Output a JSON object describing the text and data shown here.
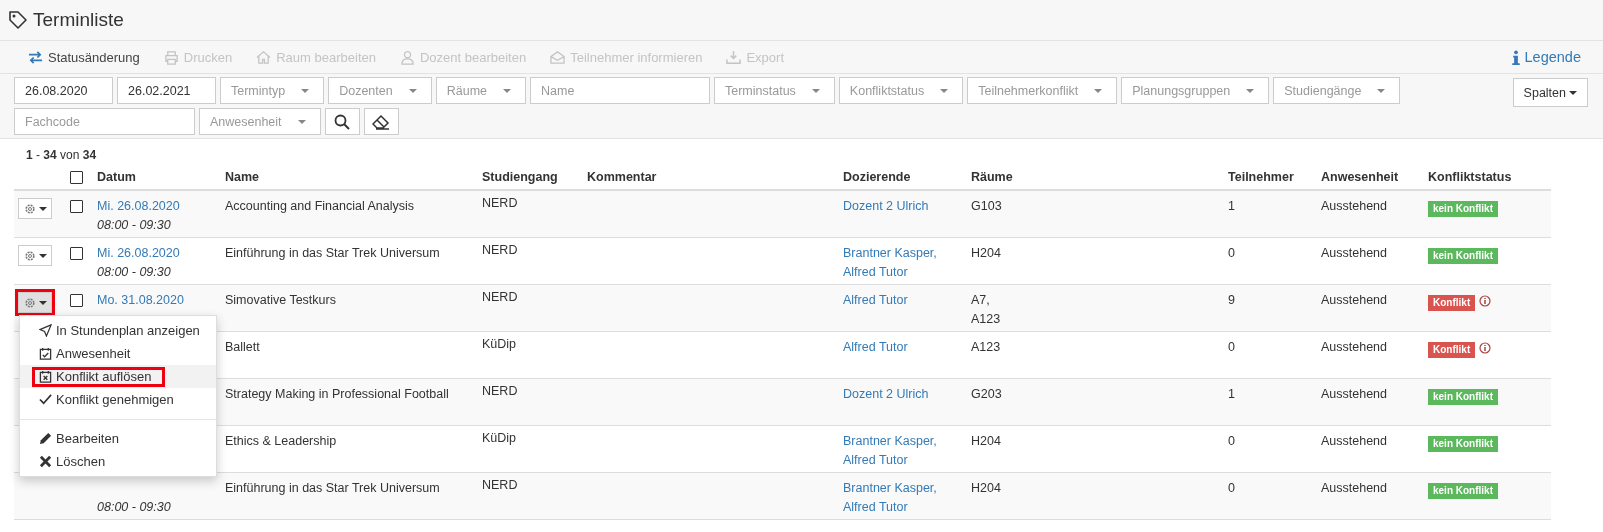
{
  "title": "Terminliste",
  "toolbar": [
    {
      "label": "Statusänderung",
      "disabled": false
    },
    {
      "label": "Drucken",
      "disabled": true
    },
    {
      "label": "Raum bearbeiten",
      "disabled": true
    },
    {
      "label": "Dozent bearbeiten",
      "disabled": true
    },
    {
      "label": "Teilnehmer informieren",
      "disabled": true
    },
    {
      "label": "Export",
      "disabled": true
    }
  ],
  "legend": {
    "label": "Legende"
  },
  "filters": [
    {
      "kind": "date",
      "value": "26.08.2020"
    },
    {
      "kind": "date",
      "value": "26.02.2021"
    },
    {
      "kind": "select",
      "placeholder": "Termintyp"
    },
    {
      "kind": "select",
      "placeholder": "Dozenten"
    },
    {
      "kind": "select",
      "placeholder": "Räume"
    },
    {
      "kind": "text",
      "placeholder": "Name"
    },
    {
      "kind": "select",
      "placeholder": "Terminstatus"
    },
    {
      "kind": "select",
      "placeholder": "Konfliktstatus"
    },
    {
      "kind": "select",
      "placeholder": "Teilnehmerkonflikt"
    },
    {
      "kind": "select",
      "placeholder": "Planungsgruppen"
    },
    {
      "kind": "select",
      "placeholder": "Studiengänge"
    },
    {
      "kind": "text",
      "placeholder": "Fachcode"
    },
    {
      "kind": "select",
      "placeholder": "Anwesenheit"
    },
    {
      "kind": "search"
    },
    {
      "kind": "clear"
    }
  ],
  "columns_button": {
    "label": "Spalten"
  },
  "count": "**1** - **34** von **34**",
  "table": {
    "select_all_checked": false,
    "columns": [
      "Datum",
      "Name",
      "Studiengang",
      "Kommentar",
      "Dozierende",
      "Räume",
      "Teilnehmer",
      "Anwesenheit",
      "Konfliktstatus"
    ],
    "rows": [
      {
        "covered": false,
        "menu_open": false,
        "checked": false,
        "date": "Mi. 26.08.2020",
        "time": "08:00 - 09:30",
        "name": "Accounting and Financial Analysis",
        "study": "NERD",
        "lecturers": [
          "Dozent 2 Ulrich"
        ],
        "rooms": [
          "G103"
        ],
        "participants": "1",
        "attendance": "Ausstehend",
        "status": {
          "kind": "ok",
          "label": "kein Konflikt"
        }
      },
      {
        "covered": false,
        "menu_open": false,
        "checked": false,
        "date": "Mi. 26.08.2020",
        "time": "08:00 - 09:30",
        "name": "Einführung in das Star Trek Universum",
        "study": "NERD",
        "lecturers": [
          "Brantner Kasper,",
          "Alfred Tutor"
        ],
        "rooms": [
          "H204"
        ],
        "participants": "0",
        "attendance": "Ausstehend",
        "status": {
          "kind": "ok",
          "label": "kein Konflikt"
        }
      },
      {
        "covered": false,
        "menu_open": true,
        "checked": false,
        "date": "Mo. 31.08.2020",
        "name": "Simovative Testkurs",
        "study": "NERD",
        "lecturers": [
          "Alfred Tutor"
        ],
        "rooms": [
          "A7,",
          "A123"
        ],
        "participants": "9",
        "attendance": "Ausstehend",
        "status": {
          "kind": "conflict",
          "label": "Konflikt"
        }
      },
      {
        "covered": true,
        "name": "Ballett",
        "study": "KüDip",
        "lecturers": [
          "Alfred Tutor"
        ],
        "rooms": [
          "A123"
        ],
        "participants": "0",
        "attendance": "Ausstehend",
        "status": {
          "kind": "conflict",
          "label": "Konflikt"
        }
      },
      {
        "covered": true,
        "name": "Strategy Making in Professional Football",
        "study": "NERD",
        "lecturers": [
          "Dozent 2 Ulrich"
        ],
        "rooms": [
          "G203"
        ],
        "participants": "1",
        "attendance": "Ausstehend",
        "status": {
          "kind": "ok",
          "label": "kein Konflikt"
        }
      },
      {
        "covered": true,
        "name": "Ethics & Leadership",
        "study": "KüDip",
        "lecturers": [
          "Brantner Kasper,",
          "Alfred Tutor"
        ],
        "rooms": [
          "H204"
        ],
        "participants": "0",
        "attendance": "Ausstehend",
        "status": {
          "kind": "ok",
          "label": "kein Konflikt"
        }
      },
      {
        "covered": true,
        "time": "08:00 - 09:30",
        "name": "Einführung in das Star Trek Universum",
        "study": "NERD",
        "lecturers": [
          "Brantner Kasper,",
          "Alfred Tutor"
        ],
        "rooms": [
          "H204"
        ],
        "participants": "0",
        "attendance": "Ausstehend",
        "status": {
          "kind": "ok",
          "label": "kein Konflikt"
        }
      }
    ]
  },
  "menu": {
    "groups": [
      [
        {
          "label": "In Stundenplan anzeigen",
          "selected": false
        },
        {
          "label": "Anwesenheit",
          "selected": false
        },
        {
          "label": "Konflikt auflösen",
          "selected": true
        },
        {
          "label": "Konflikt genehmigen",
          "selected": false
        }
      ],
      [
        {
          "label": "Bearbeiten",
          "selected": false
        },
        {
          "label": "Löschen",
          "selected": false
        }
      ]
    ]
  }
}
